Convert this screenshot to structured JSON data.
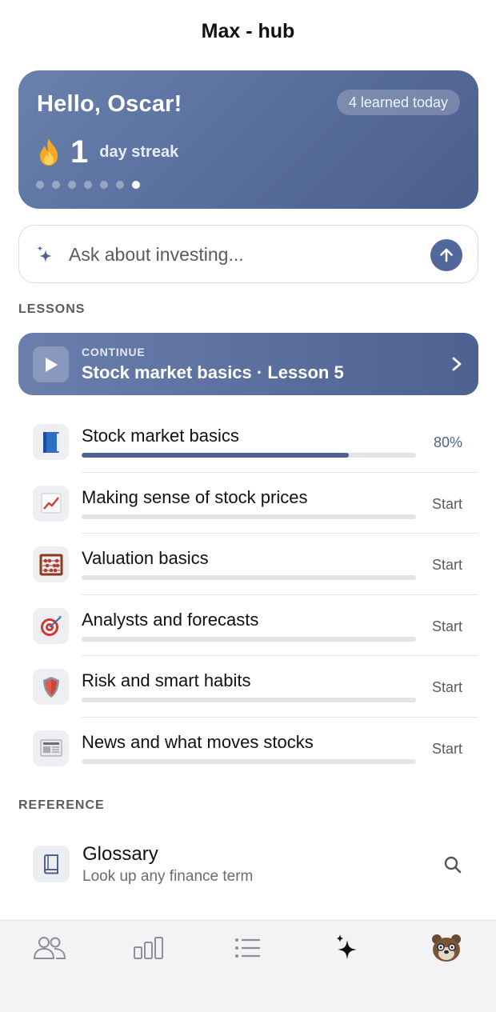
{
  "header": {
    "title": "Max - hub"
  },
  "hero": {
    "greeting": "Hello, Oscar!",
    "badge": "4 learned today",
    "streak_number": "1",
    "streak_label": "day streak",
    "flame_icon": "flame-icon",
    "dots_total": 7,
    "dots_active_index": 6,
    "accent_color": "#5a709f"
  },
  "ask": {
    "placeholder": "Ask about investing...",
    "spark_icon": "sparkle-icon",
    "send_icon": "arrow-up-icon"
  },
  "sections": {
    "lessons_label": "LESSONS",
    "reference_label": "REFERENCE"
  },
  "continue": {
    "kicker": "CONTINUE",
    "title": "Stock market basics · Lesson 5",
    "play_icon": "play-icon",
    "chevron_icon": "chevron-right-icon"
  },
  "lessons": [
    {
      "title": "Stock market basics",
      "status": "80%",
      "progress": 0.8,
      "icon": "blue-book-icon"
    },
    {
      "title": "Making sense of stock prices",
      "status": "Start",
      "progress": 0,
      "icon": "chart-increasing-icon"
    },
    {
      "title": "Valuation basics",
      "status": "Start",
      "progress": 0,
      "icon": "abacus-icon"
    },
    {
      "title": "Analysts and forecasts",
      "status": "Start",
      "progress": 0,
      "icon": "target-dart-icon"
    },
    {
      "title": "Risk and smart habits",
      "status": "Start",
      "progress": 0,
      "icon": "shield-icon"
    },
    {
      "title": "News and what moves stocks",
      "status": "Start",
      "progress": 0,
      "icon": "newspaper-icon"
    }
  ],
  "glossary": {
    "title": "Glossary",
    "subtitle": "Look up any finance term",
    "icon": "book-icon",
    "action_icon": "search-icon"
  },
  "tabbar": {
    "items": [
      {
        "icon": "people-icon",
        "active": false
      },
      {
        "icon": "bar-chart-icon",
        "active": false
      },
      {
        "icon": "list-icon",
        "active": false
      },
      {
        "icon": "sparkle-icon",
        "active": true
      },
      {
        "icon": "avatar-bear-icon",
        "active": false
      }
    ]
  },
  "colors": {
    "brand": "#4e6292",
    "progress_track": "#e3e4e8",
    "status_text": "#5a5a60"
  }
}
